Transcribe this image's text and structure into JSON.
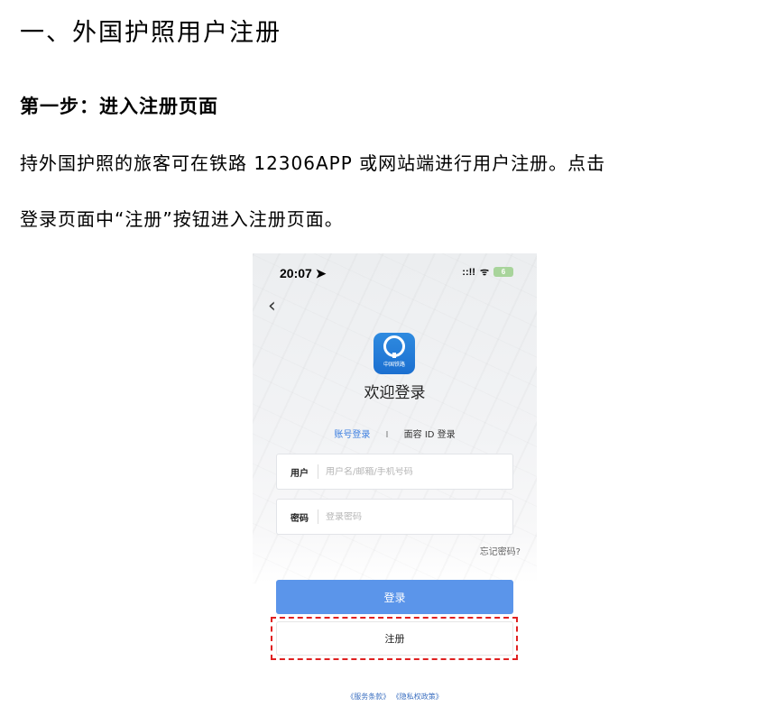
{
  "document": {
    "title": "一、外国护照用户注册",
    "step_title": "第一步：进入注册页面",
    "paragraph_line1": "持外国护照的旅客可在铁路 12306APP 或网站端进行用户注册。点击",
    "paragraph_line2": "登录页面中“注册”按钮进入注册页面。"
  },
  "phone": {
    "status_time": "20:07",
    "status_location_icon": "location-arrow-icon",
    "status_signal": "::!!",
    "status_wifi": "ᯤ",
    "battery_level": "6",
    "back_icon": "‹",
    "app_logo_text": "中国铁路",
    "welcome": "欢迎登录",
    "tabs": {
      "account": "账号登录",
      "separator": "I",
      "face_id": "面容 ID 登录"
    },
    "username": {
      "label": "用户",
      "placeholder": "用户名/邮箱/手机号码",
      "value": ""
    },
    "password": {
      "label": "密码",
      "placeholder": "登录密码",
      "value": ""
    },
    "forgot": "忘记密码?",
    "login_button": "登录",
    "register_button": "注册",
    "terms_service": "《服务条款》",
    "terms_privacy": "《隐私权政策》",
    "highlight_color": "#e02020",
    "accent_color": "#5b95ea"
  }
}
